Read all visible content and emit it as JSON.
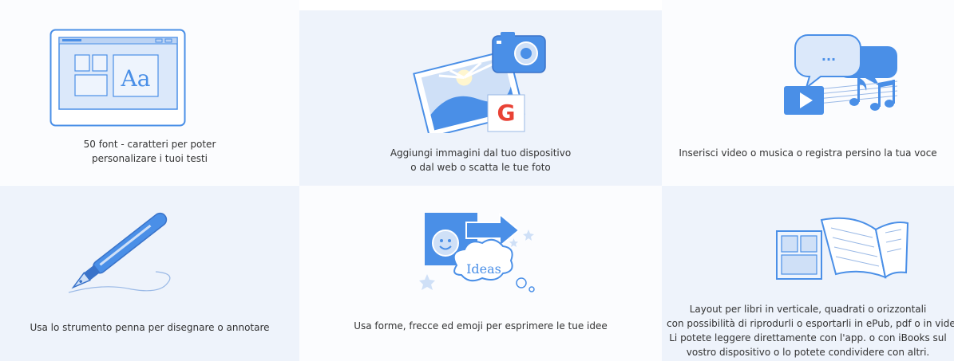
{
  "features": [
    {
      "icon": "font-window-icon",
      "caption": [
        "50 font - caratteri per poter",
        "personalizare i tuoi testi"
      ],
      "illustration_text": "Aa"
    },
    {
      "icon": "camera-photo-google-icon",
      "caption": [
        "Aggiungi immagini dal tuo dispositivo",
        "o dal web o scatta le tue foto"
      ],
      "illustration_text": "G"
    },
    {
      "icon": "video-music-chat-icon",
      "caption": [
        "Inserisci video o musica o registra persino la tua voce"
      ],
      "illustration_text": "..."
    },
    {
      "icon": "fountain-pen-icon",
      "caption": [
        "Usa lo strumento penna per disegnare o annotare"
      ]
    },
    {
      "icon": "shapes-arrows-emoji-icon",
      "caption": [
        "Usa forme, frecce ed emoji per esprimere le tue idee"
      ],
      "illustration_text": "Ideas"
    },
    {
      "icon": "book-layout-icon",
      "caption": [
        "Layout per libri in verticale, quadrati o orizzontali",
        "con possibilità di riprodurli o esportarli in ePub, pdf o in video",
        "Li potete leggere direttamente con l'app. o con iBooks sul",
        "vostro dispositivo o lo potete condividere con altri."
      ]
    }
  ],
  "colors": {
    "primary": "#4a8fe7",
    "light": "#cfe0f7",
    "stroke": "#3a73c9",
    "tile_shaded": "#eef3fb"
  }
}
